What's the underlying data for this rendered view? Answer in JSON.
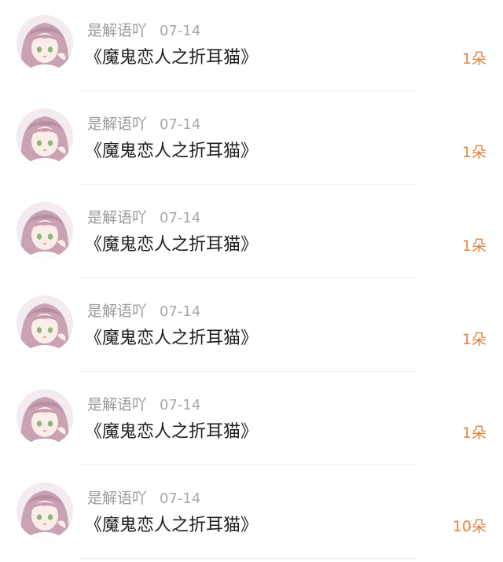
{
  "gift_list": {
    "items": [
      {
        "user_name": "是解语吖",
        "date": "07-14",
        "gift_title": "《魔鬼恋人之折耳猫》",
        "count": "1朵"
      },
      {
        "user_name": "是解语吖",
        "date": "07-14",
        "gift_title": "《魔鬼恋人之折耳猫》",
        "count": "1朵"
      },
      {
        "user_name": "是解语吖",
        "date": "07-14",
        "gift_title": "《魔鬼恋人之折耳猫》",
        "count": "1朵"
      },
      {
        "user_name": "是解语吖",
        "date": "07-14",
        "gift_title": "《魔鬼恋人之折耳猫》",
        "count": "1朵"
      },
      {
        "user_name": "是解语吖",
        "date": "07-14",
        "gift_title": "《魔鬼恋人之折耳猫》",
        "count": "1朵"
      },
      {
        "user_name": "是解语吖",
        "date": "07-14",
        "gift_title": "《魔鬼恋人之折耳猫》",
        "count": "10朵"
      }
    ]
  },
  "colors": {
    "count_accent": "#e3823c",
    "name_gray": "#9a9a9a",
    "title_text": "#1e1e1e",
    "avatar_hair": "#c9a3b4"
  },
  "icons": {
    "avatar": "anime-girl-avatar-icon"
  }
}
